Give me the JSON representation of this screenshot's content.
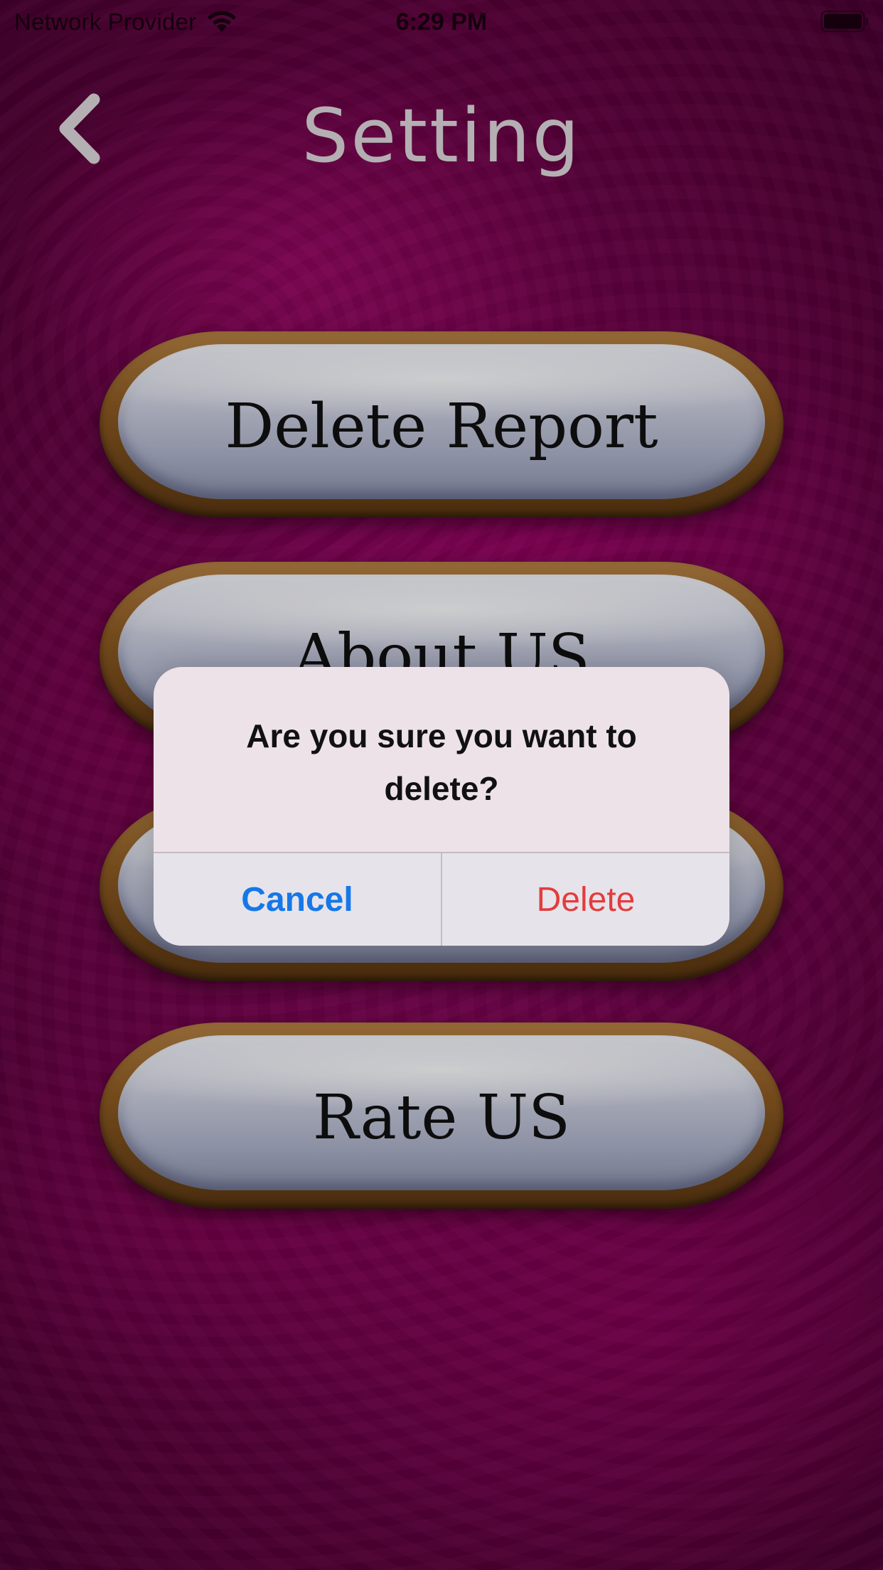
{
  "status_bar": {
    "carrier": "Network Provider",
    "time": "6:29 PM",
    "wifi_icon": "wifi-icon",
    "battery_icon": "battery-icon"
  },
  "nav": {
    "back_icon": "chevron-left-icon",
    "title": "Setting"
  },
  "menu": {
    "items": [
      {
        "label": "Delete Report"
      },
      {
        "label": "About US"
      },
      {
        "label": ""
      },
      {
        "label": "Rate US"
      }
    ]
  },
  "alert": {
    "message": "Are you sure you want to delete?",
    "cancel_label": "Cancel",
    "delete_label": "Delete"
  },
  "colors": {
    "background": "#7a044f",
    "cancel": "#1677e8",
    "delete": "#e33d3d",
    "title": "#dcd6da"
  }
}
